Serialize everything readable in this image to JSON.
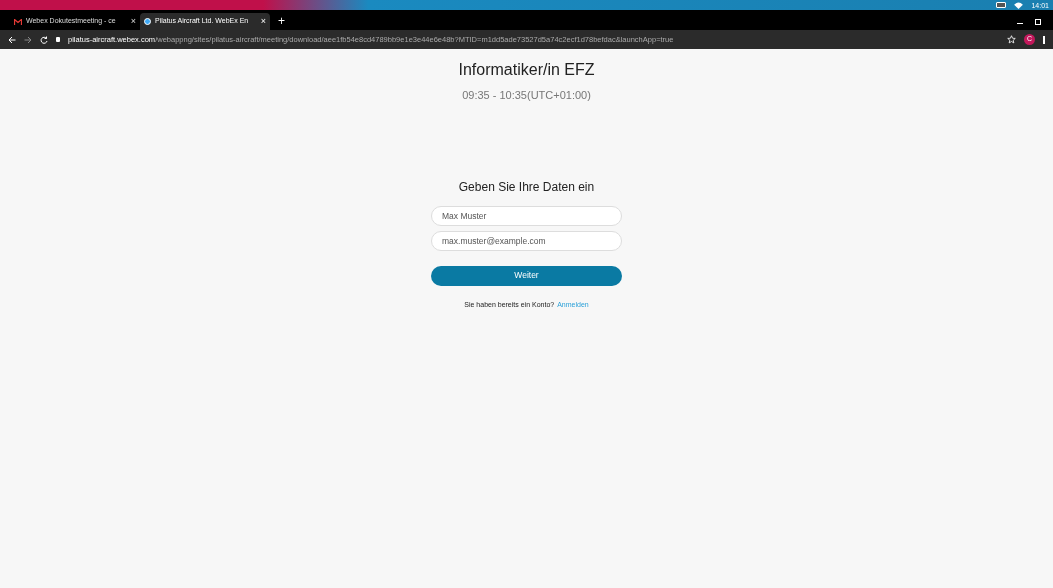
{
  "system_bar": {
    "clock": "14:01"
  },
  "tabs": [
    {
      "title": "Webex Dokutestmeeting - ce",
      "close": "×",
      "selected": false,
      "kind": "mail"
    },
    {
      "title": "Pilatus Aircraft Ltd. WebEx En",
      "close": "×",
      "selected": true,
      "kind": "webex"
    }
  ],
  "new_tab": "+",
  "address_bar": {
    "domain": "pilatus-aircraft.webex.com",
    "path": "/webappng/sites/pilatus-aircraft/meeting/download/aee1fb54e8cd4789bb9e1e3e44e6e48b?MTID=m1dd5ade73527d5a74c2ecf1d78befdac&launchApp=true",
    "profile": "C"
  },
  "meeting": {
    "title": "Informatiker/in EFZ",
    "time": "09:35 - 10:35(UTC+01:00)"
  },
  "form": {
    "heading": "Geben Sie Ihre Daten ein",
    "fields": [
      {
        "placeholder": "Max Muster"
      },
      {
        "placeholder": "max.muster@example.com"
      }
    ],
    "button": "Weiter",
    "account_text": "Sie haben bereits ein Konto?",
    "login_link": "Anmelden"
  }
}
